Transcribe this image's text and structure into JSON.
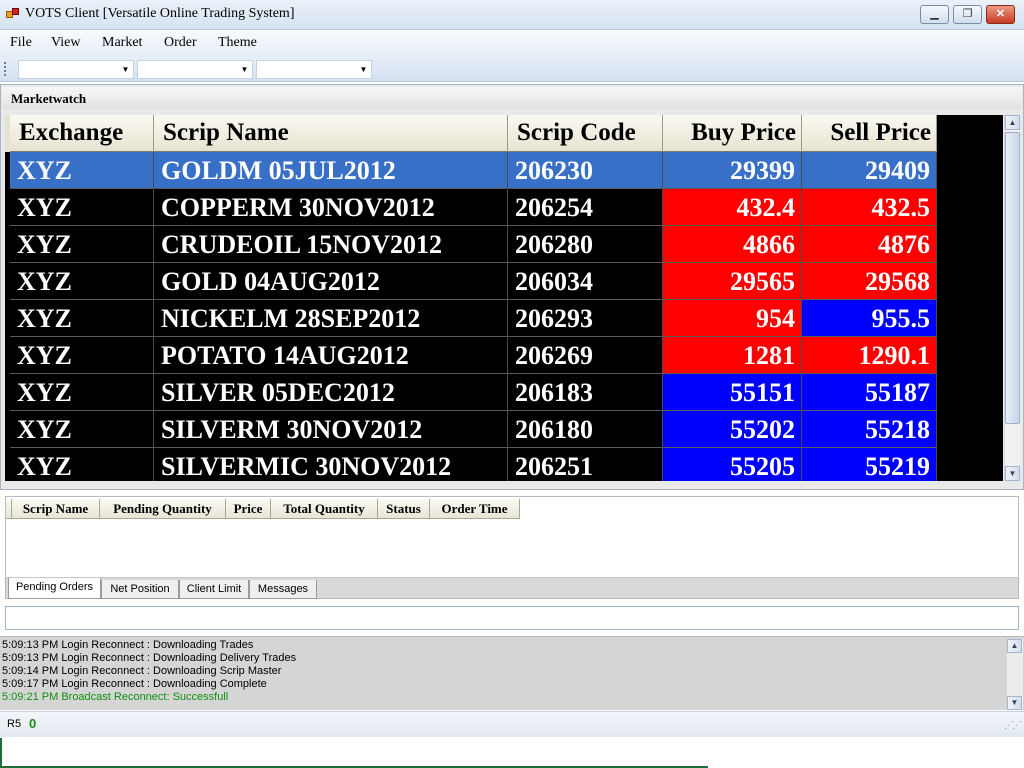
{
  "window": {
    "title": "VOTS Client [Versatile Online Trading System]",
    "minimize_glyph": "▁",
    "restore_glyph": "❐",
    "close_glyph": "✕"
  },
  "menu": [
    "File",
    "View",
    "Market",
    "Order",
    "Theme"
  ],
  "toolbar": {
    "combos": [
      "",
      "",
      ""
    ]
  },
  "marketwatch": {
    "title": "Marketwatch",
    "columns": [
      "Exchange",
      "Scrip Name",
      "Scrip Code",
      "Buy Price",
      "Sell Price"
    ],
    "rows": [
      {
        "exchange": "XYZ",
        "scrip_name": " GOLDM  05JUL2012",
        "scrip_code": "206230",
        "buy": "29399",
        "sell": "29409",
        "buy_color": "#3770c6",
        "sell_color": "#3770c6",
        "selected": true
      },
      {
        "exchange": "XYZ",
        "scrip_name": "COPPERM  30NOV2012",
        "scrip_code": "206254",
        "buy": "432.4",
        "sell": "432.5",
        "buy_color": "#ff0000",
        "sell_color": "#ff0000"
      },
      {
        "exchange": "XYZ",
        "scrip_name": "CRUDEOIL  15NOV2012",
        "scrip_code": "206280",
        "buy": "4866",
        "sell": "4876",
        "buy_color": "#ff0000",
        "sell_color": "#ff0000"
      },
      {
        "exchange": "XYZ",
        "scrip_name": "GOLD  04AUG2012",
        "scrip_code": "206034",
        "buy": "29565",
        "sell": "29568",
        "buy_color": "#ff0000",
        "sell_color": "#ff0000"
      },
      {
        "exchange": "XYZ",
        "scrip_name": "NICKELM  28SEP2012",
        "scrip_code": "206293",
        "buy": "954",
        "sell": "955.5",
        "buy_color": "#ff0000",
        "sell_color": "#0000ff"
      },
      {
        "exchange": "XYZ",
        "scrip_name": "POTATO  14AUG2012",
        "scrip_code": "206269",
        "buy": "1281",
        "sell": "1290.1",
        "buy_color": "#ff0000",
        "sell_color": "#ff0000"
      },
      {
        "exchange": "XYZ",
        "scrip_name": "SILVER  05DEC2012",
        "scrip_code": "206183",
        "buy": "55151",
        "sell": "55187",
        "buy_color": "#0000ff",
        "sell_color": "#0000ff"
      },
      {
        "exchange": "XYZ",
        "scrip_name": "SILVERM  30NOV2012",
        "scrip_code": "206180",
        "buy": "55202",
        "sell": "55218",
        "buy_color": "#0000ff",
        "sell_color": "#0000ff"
      },
      {
        "exchange": "XYZ",
        "scrip_name": "SILVERMIC  30NOV2012",
        "scrip_code": "206251",
        "buy": "55205",
        "sell": "55219",
        "buy_color": "#0000ff",
        "sell_color": "#0000ff"
      }
    ]
  },
  "orders": {
    "columns": [
      "Scrip Name",
      "Pending Quantity",
      "Price",
      "Total Quantity",
      "Status",
      "Order Time"
    ],
    "tabs": [
      "Pending Orders",
      "Net Position",
      "Client Limit",
      "Messages"
    ],
    "active_tab": "Pending Orders"
  },
  "log": [
    {
      "text": "5:09:13 PM Login Reconnect : Downloading Trades",
      "color": "black"
    },
    {
      "text": "5:09:13 PM Login Reconnect : Downloading Delivery Trades",
      "color": "black"
    },
    {
      "text": "5:09:14 PM Login Reconnect : Downloading Scrip Master",
      "color": "black"
    },
    {
      "text": "5:09:17 PM Login Reconnect : Downloading Complete",
      "color": "black"
    },
    {
      "text": "5:09:21 PM Broadcast Reconnect: Successfull",
      "color": "green"
    }
  ],
  "status": {
    "label": "R5",
    "value": "0"
  }
}
